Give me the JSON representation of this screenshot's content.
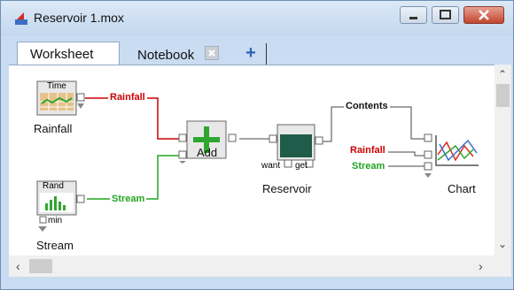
{
  "window": {
    "title": "Reservoir 1.mox"
  },
  "tabs": {
    "worksheet": "Worksheet",
    "notebook": "Notebook",
    "add": "+"
  },
  "nodes": {
    "rainfall": {
      "icon_text": "Time",
      "label": "Rainfall"
    },
    "stream": {
      "icon_text": "Rand",
      "label": "Stream",
      "option": "min"
    },
    "add": {
      "label": "Add"
    },
    "reservoir": {
      "label": "Reservoir",
      "want": "want",
      "get": "get"
    },
    "chart": {
      "label": "Chart"
    }
  },
  "wires": {
    "rainfall": "Rainfall",
    "stream": "Stream",
    "contents": "Contents",
    "chart_rainfall": "Rainfall",
    "chart_stream": "Stream"
  },
  "colors": {
    "rainfall": "#cc0000",
    "stream": "#22a322",
    "wire": "#444444",
    "accent": "#2a62b8"
  },
  "icons": {
    "app": "moxie-app-icon",
    "minimize": "minimize-icon",
    "maximize": "maximize-icon",
    "close": "close-icon",
    "tab_close": "tab-close-icon",
    "add_tab": "plus-icon"
  }
}
